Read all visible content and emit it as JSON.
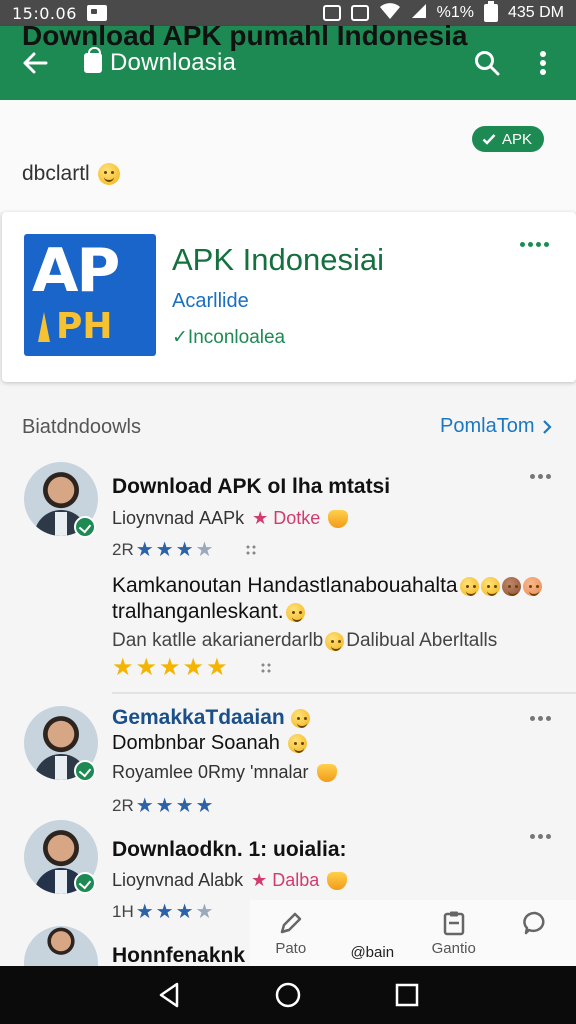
{
  "status_bar": {
    "time": "15:0.06",
    "battery": "%1%",
    "clock_right": "435 DM"
  },
  "app_bar": {
    "title": "Downloasia"
  },
  "header": {
    "title": "Download APK pumahl Indonesia",
    "badge": "APK",
    "subtitle": "dbclartl"
  },
  "app_card": {
    "logo_top": "AP",
    "logo_bottom": "PH",
    "name": "APK Indonesiai",
    "developer": "Acarllide",
    "install": "Inconloalea"
  },
  "section": {
    "title": "Biatdndoowls",
    "link": "PomlaTom"
  },
  "reviews": [
    {
      "title": "Download APK οI lha mtatsi",
      "meta": "Lioynvnad АAPk",
      "tag": "Dotke",
      "count": "2R",
      "stars_filled": 3,
      "stars_total": 4,
      "body_line1": "Kamkanoutan Handastlanabouahalta",
      "body_line2": "tralhanganleskant.",
      "note": "Dan katlle akarianerdarlb",
      "note_tail": "Dalibual Aberltalls",
      "rating": 5
    },
    {
      "title": "GemakkaTdaaian",
      "meta": "Dombnbar Soanah",
      "sub": "Royamlee 0Rmy 'mnalar",
      "count": "2R",
      "stars_filled": 4,
      "stars_total": 4
    },
    {
      "title": "Downlaodkn. 1: uoialia:",
      "meta": "Lioynvnad Alabk",
      "tag": "Dalba",
      "count": "1H",
      "stars_filled": 3,
      "stars_total": 4
    },
    {
      "title": "Honnfenaknk"
    }
  ],
  "bottom_tools": [
    {
      "icon": "pen-icon",
      "label": "Pato"
    },
    {
      "icon": "",
      "label": "@bain"
    },
    {
      "icon": "clipboard-icon",
      "label": "Gantio"
    },
    {
      "icon": "chat-bubble-icon",
      "label": ""
    }
  ],
  "colors": {
    "brand_green": "#1d8a53",
    "link_blue": "#1a78c2",
    "status_bar": "#4a4a4a"
  }
}
